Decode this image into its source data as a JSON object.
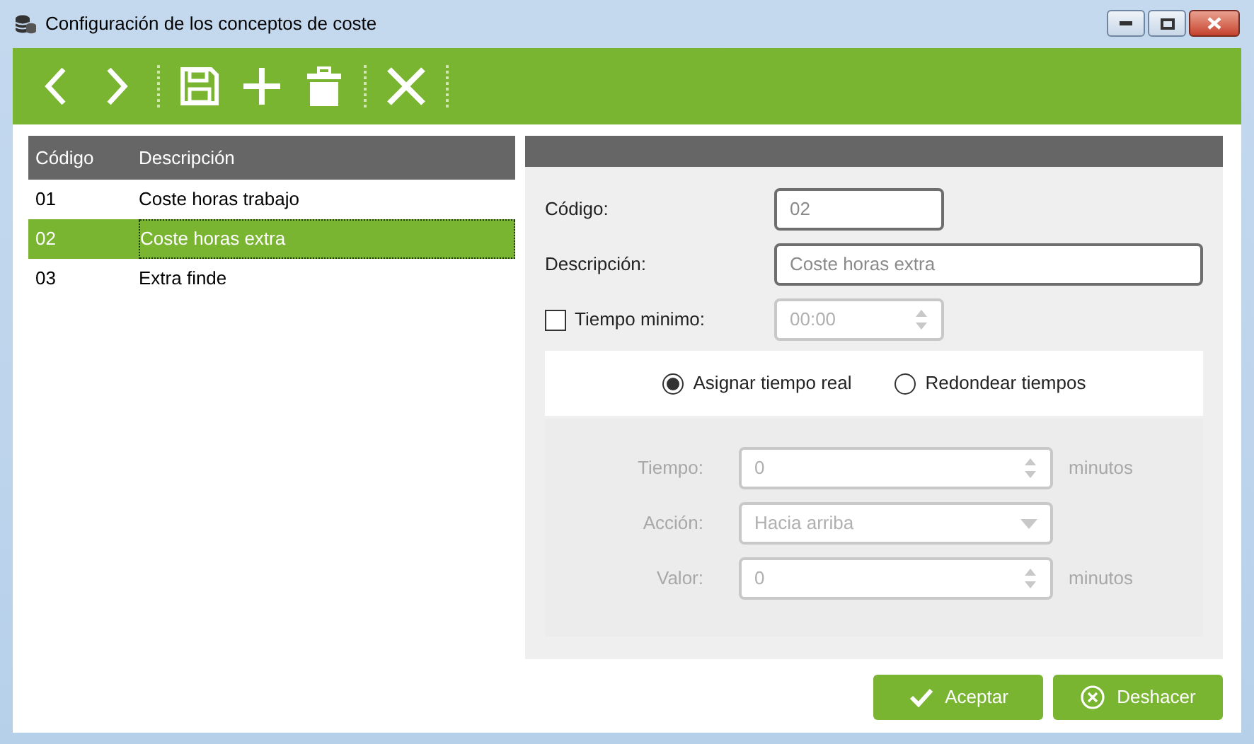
{
  "window": {
    "title": "Configuración de los conceptos de coste"
  },
  "list": {
    "columns": [
      "Código",
      "Descripción"
    ],
    "rows": [
      {
        "code": "01",
        "description": "Coste horas trabajo",
        "selected": false
      },
      {
        "code": "02",
        "description": "Coste horas extra",
        "selected": true
      },
      {
        "code": "03",
        "description": "Extra finde",
        "selected": false
      }
    ]
  },
  "form": {
    "code": {
      "label": "Código:",
      "value": "02"
    },
    "description": {
      "label": "Descripción:",
      "value": "Coste horas extra"
    },
    "minimum_time": {
      "label": "Tiempo minimo:",
      "checked": false,
      "value": "00:00"
    },
    "mode_options": [
      {
        "label": "Asignar tiempo real",
        "selected": true
      },
      {
        "label": "Redondear tiempos",
        "selected": false
      }
    ],
    "rounding": {
      "disabled": true,
      "fields": [
        {
          "kind": "spinner",
          "label": "Tiempo:",
          "value": "0",
          "unit": "minutos"
        },
        {
          "kind": "dropdown",
          "label": "Acción:",
          "value": "Hacia arriba"
        },
        {
          "kind": "spinner",
          "label": "Valor:",
          "value": "0",
          "unit": "minutos"
        }
      ]
    }
  },
  "buttons": [
    {
      "kind": "accept",
      "label": "Aceptar"
    },
    {
      "kind": "undo",
      "label": "Deshacer"
    }
  ]
}
